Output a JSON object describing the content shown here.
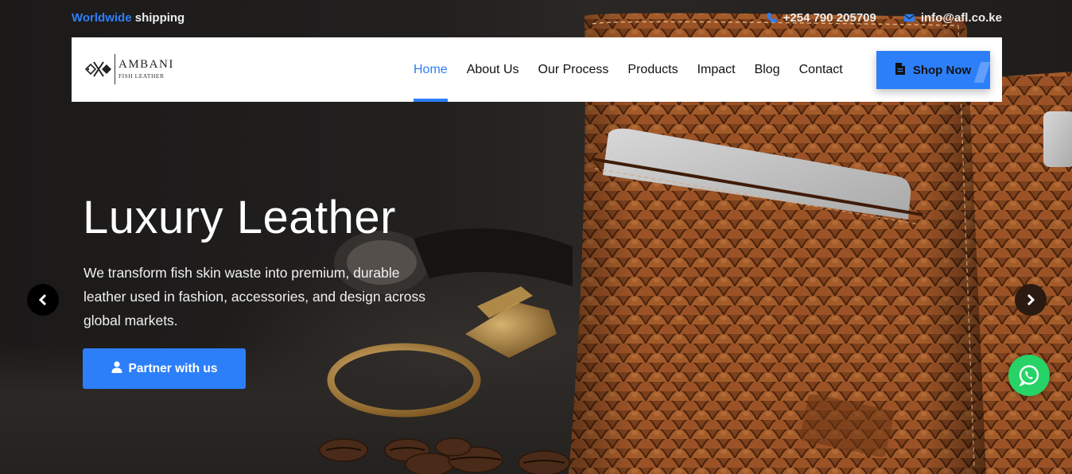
{
  "topbar": {
    "shipping_accent": "Worldwide",
    "shipping_rest": " shipping",
    "phone": "+254 790 205709",
    "email": "info@afl.co.ke",
    "phone_icon": "phone-icon",
    "email_icon": "envelope-icon"
  },
  "logo": {
    "name": "AMBANI",
    "subtitle": "FISH LEATHER"
  },
  "nav": {
    "items": [
      {
        "label": "Home",
        "active": true
      },
      {
        "label": "About Us"
      },
      {
        "label": "Our Process"
      },
      {
        "label": "Products"
      },
      {
        "label": "Impact"
      },
      {
        "label": "Blog"
      },
      {
        "label": "Contact"
      }
    ],
    "cta_label": "Shop Now",
    "cta_icon": "document-icon"
  },
  "hero": {
    "title": "Luxury Leather",
    "text": "We transform fish skin waste into premium, durable leather used in fashion, accessories, and design across global markets.",
    "button_label": "Partner with us",
    "button_icon": "user-icon"
  },
  "carousel": {
    "prev_icon": "chevron-left-icon",
    "next_icon": "chevron-right-icon"
  },
  "floating": {
    "whatsapp_icon": "whatsapp-icon"
  },
  "colors": {
    "accent": "#2d7ff9",
    "whatsapp": "#25d366",
    "leather": "#8a4a22"
  }
}
